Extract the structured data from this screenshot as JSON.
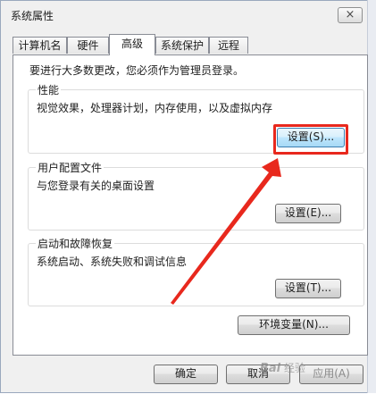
{
  "window": {
    "title": "系统属性",
    "close_glyph": "×"
  },
  "tabs": [
    {
      "label": "计算机名",
      "active": false
    },
    {
      "label": "硬件",
      "active": false
    },
    {
      "label": "高级",
      "active": true
    },
    {
      "label": "系统保护",
      "active": false
    },
    {
      "label": "远程",
      "active": false
    }
  ],
  "advanced": {
    "admin_note": "要进行大多数更改，您必须作为管理员登录。",
    "performance": {
      "title": "性能",
      "description": "视觉效果，处理器计划，内存使用，以及虚拟内存",
      "button": "设置(S)..."
    },
    "user_profiles": {
      "title": "用户配置文件",
      "description": "与您登录有关的桌面设置",
      "button": "设置(E)..."
    },
    "startup_recovery": {
      "title": "启动和故障恢复",
      "description": "系统启动、系统失败和调试信息",
      "button": "设置(T)..."
    },
    "env_button": "环境变量(N)..."
  },
  "footer": {
    "ok": "确定",
    "cancel": "取消",
    "apply": "应用(A)"
  },
  "annotation": {
    "color": "#e8281d"
  },
  "watermark": {
    "logo": "Bai",
    "text": "经验"
  }
}
